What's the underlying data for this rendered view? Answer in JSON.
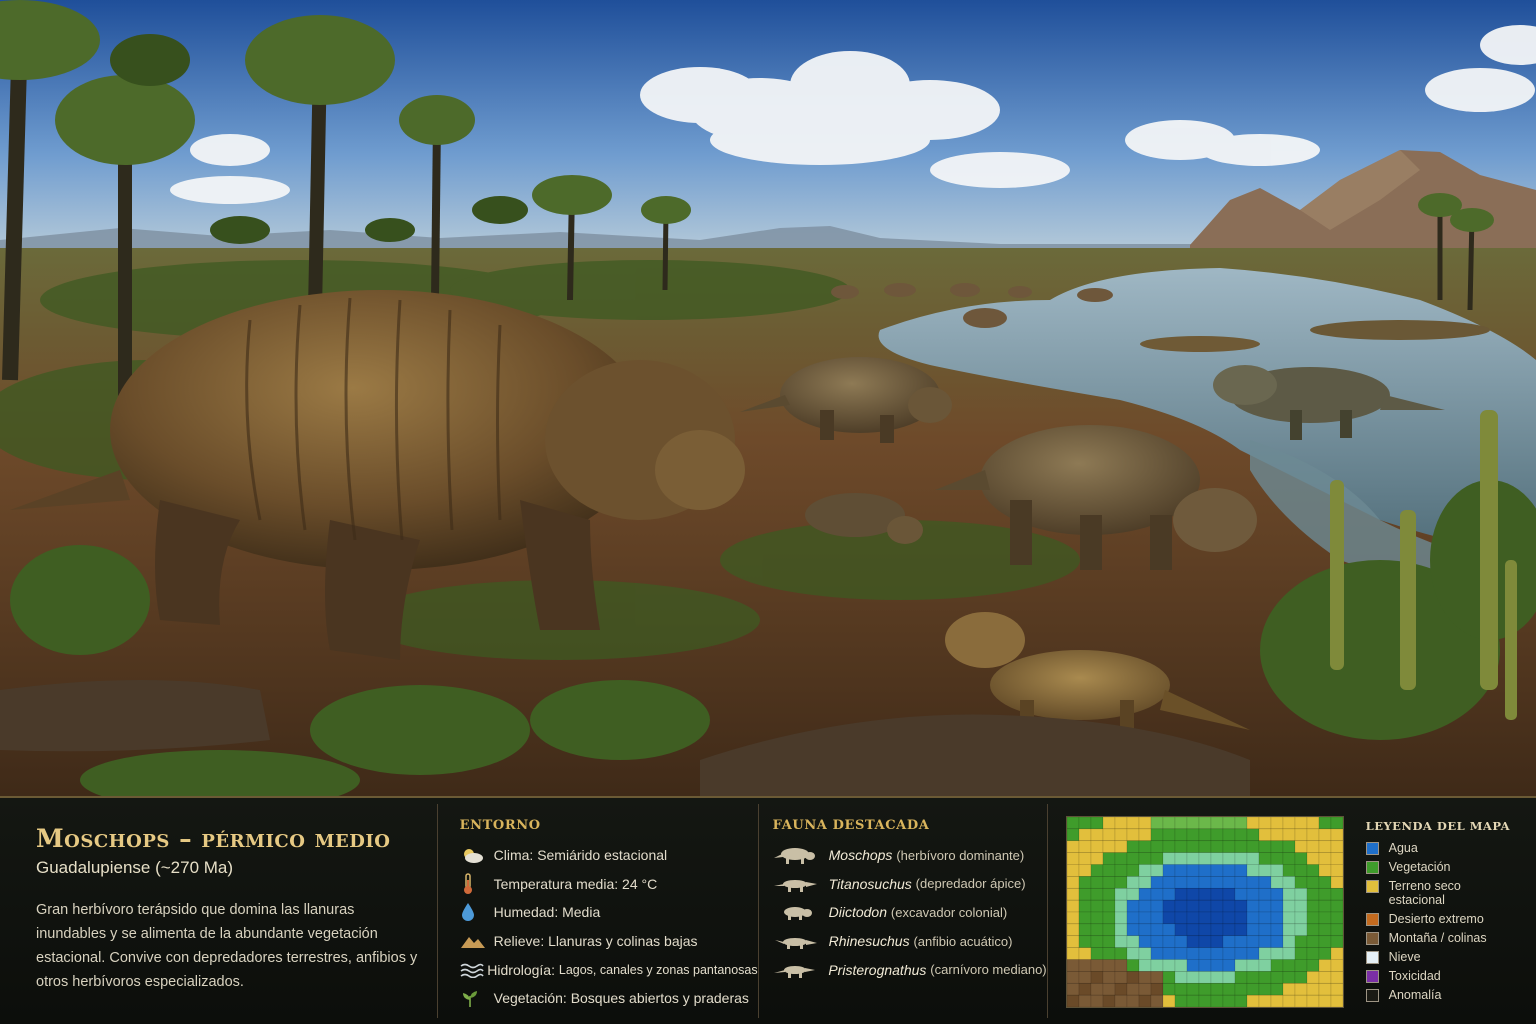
{
  "title": {
    "name": "Moschops",
    "period": "pérmico medio",
    "subtitle": "Guadalupiense (~270 Ma)",
    "description": "Gran herbívoro terápsido que domina las llanuras inundables y se alimenta de la abundante vegetación estacional. Convive con depredadores terrestres, anfibios y otros herbívoros especializados."
  },
  "environment": {
    "heading": "ENTORNO",
    "items": [
      {
        "icon": "sun-cloud-icon",
        "label": "Clima:",
        "value": "Semiárido estacional"
      },
      {
        "icon": "thermometer-icon",
        "label": "Temperatura media:",
        "value": "24 °C"
      },
      {
        "icon": "water-drop-icon",
        "label": "Humedad:",
        "value": "Media"
      },
      {
        "icon": "mountain-icon",
        "label": "Relieve:",
        "value": "Llanuras y colinas bajas"
      },
      {
        "icon": "waves-icon",
        "label": "Hidrología:",
        "value": "Lagos, canales y zonas pantanosas"
      },
      {
        "icon": "plant-icon",
        "label": "Vegetación:",
        "value": "Bosques abiertos y praderas"
      }
    ]
  },
  "fauna": {
    "heading": "FAUNA DESTACADA",
    "items": [
      {
        "icon": "moschops-silhouette-icon",
        "species": "Moschops",
        "note": "(herbívoro dominante)"
      },
      {
        "icon": "titanosuchus-silhouette-icon",
        "species": "Titanosuchus",
        "note": "(depredador ápice)"
      },
      {
        "icon": "diictodon-silhouette-icon",
        "species": "Diictodon",
        "note": "(excavador colonial)"
      },
      {
        "icon": "rhinesuchus-silhouette-icon",
        "species": "Rhinesuchus",
        "note": "(anfibio acuático)"
      },
      {
        "icon": "pristerognathus-silhouette-icon",
        "species": "Pristerognathus",
        "note": "(carnívoro mediano)"
      }
    ]
  },
  "legend": {
    "heading": "LEYENDA DEL MAPA",
    "items": [
      {
        "label": "Agua",
        "color": "#1f6fc9"
      },
      {
        "label": "Vegetación",
        "color": "#3f9c2b"
      },
      {
        "label": "Terreno seco estacional",
        "color": "#e2bf3c"
      },
      {
        "label": "Desierto extremo",
        "color": "#c46b1f"
      },
      {
        "label": "Montaña / colinas",
        "color": "#7a5a36"
      },
      {
        "label": "Nieve",
        "color": "#e6f0f6"
      },
      {
        "label": "Toxicidad",
        "color": "#7b2fa6"
      },
      {
        "label": "Anomalía",
        "color": "#1a1a14"
      }
    ]
  },
  "colors": {
    "accent": "#d9b45c",
    "title": "#e6c983",
    "panel_bg": "#111410"
  }
}
